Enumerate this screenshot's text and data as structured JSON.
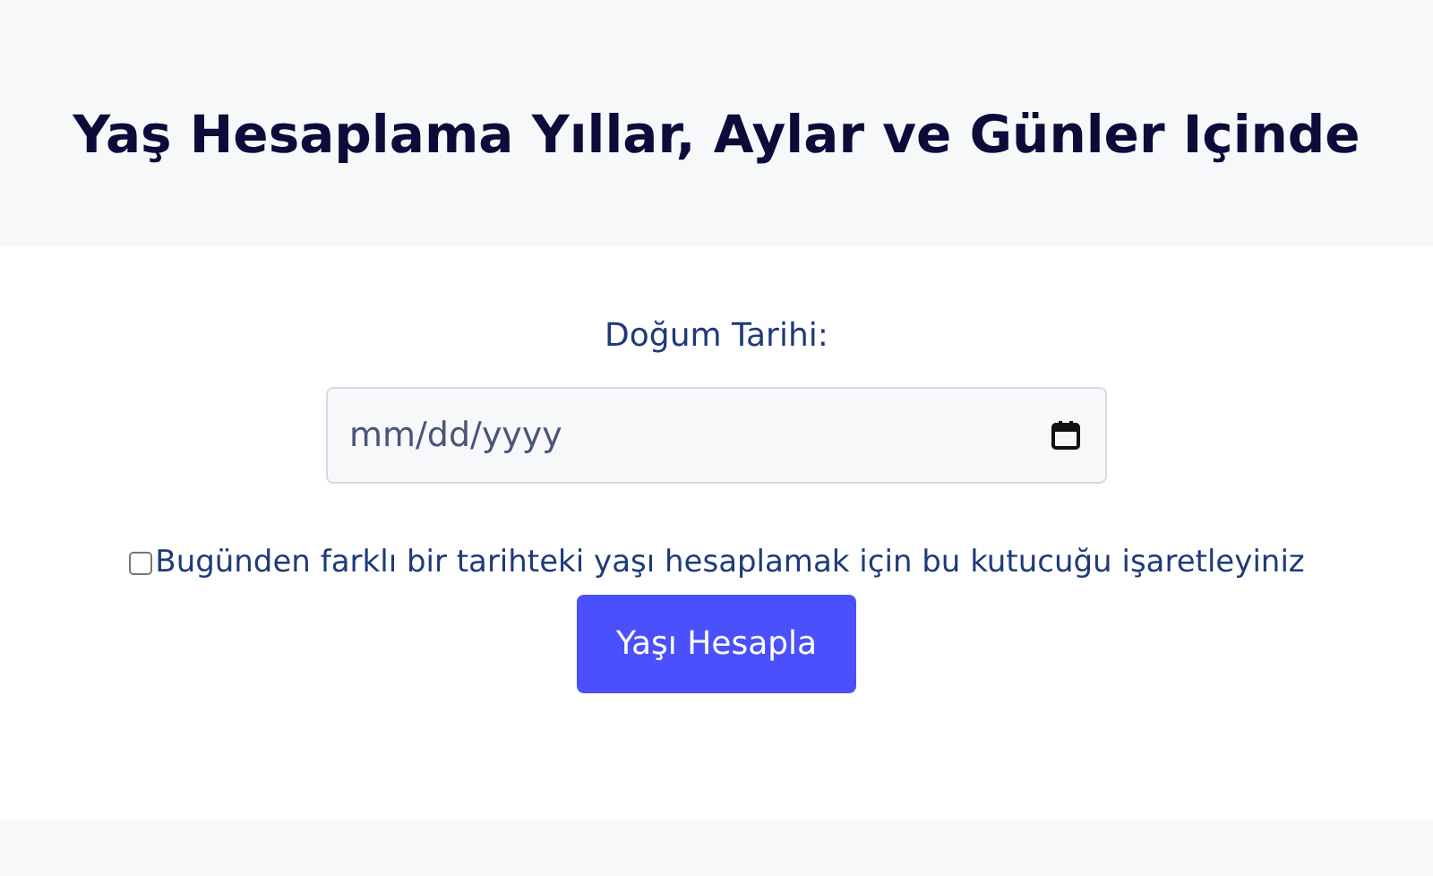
{
  "header": {
    "title": "Yaş Hesaplama Yıllar, Aylar ve Günler Içinde"
  },
  "form": {
    "date_label": "Doğum Tarihi:",
    "date_field": {
      "placeholder": "mm/dd/yyyy"
    },
    "checkbox": {
      "label": "Bugünden farklı bir tarihteki yaşı hesaplamak için bu kutucuğu işaretleyiniz",
      "checked": false
    },
    "button": "Yaşı Hesapla"
  }
}
